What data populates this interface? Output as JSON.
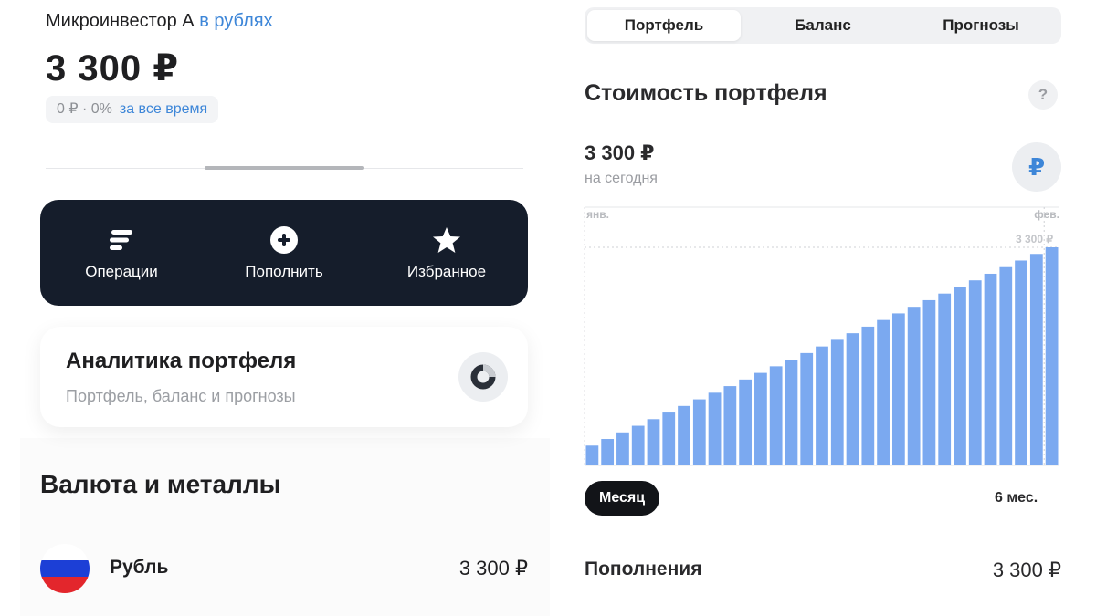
{
  "account": {
    "name": "Микроинвестор А",
    "currency_mode": "в рублях",
    "total": "3 300 ₽",
    "change": "0 ₽ · 0%",
    "change_period": "за все время"
  },
  "actions": [
    {
      "label": "Операции",
      "icon": "operations-icon"
    },
    {
      "label": "Пополнить",
      "icon": "plus-circle-icon"
    },
    {
      "label": "Избранное",
      "icon": "star-icon"
    }
  ],
  "analytics": {
    "title": "Аналитика портфеля",
    "subtitle": "Портфель, баланс и прогнозы",
    "icon": "donut-chart-icon"
  },
  "currencies_section": {
    "title": "Валюта и металлы",
    "items": [
      {
        "name": "Рубль",
        "value": "3 300 ₽",
        "icon": "russia-flag-icon"
      }
    ]
  },
  "tabs": [
    {
      "label": "Портфель",
      "active": true
    },
    {
      "label": "Баланс",
      "active": false
    },
    {
      "label": "Прогнозы",
      "active": false
    }
  ],
  "portfolio": {
    "title": "Стоимость портфеля",
    "help": "?",
    "value": "3 300 ₽",
    "value_caption": "на сегодня",
    "currency_symbol": "₽"
  },
  "chart_data": {
    "type": "bar",
    "x_labels": [
      "янв.",
      "фев."
    ],
    "max_label": "3 300 ₽",
    "values": [
      300,
      400,
      500,
      600,
      700,
      800,
      900,
      1000,
      1100,
      1200,
      1300,
      1400,
      1500,
      1600,
      1700,
      1800,
      1900,
      2000,
      2100,
      2200,
      2300,
      2400,
      2500,
      2600,
      2700,
      2800,
      2900,
      3000,
      3100,
      3200,
      3300
    ],
    "ylim": [
      0,
      3300
    ],
    "bar_color": "#7ba9f0",
    "grid": false
  },
  "periods": {
    "selected": "Месяц",
    "other": "6 мес."
  },
  "deposits": {
    "label": "Пополнения",
    "value": "3 300 ₽"
  },
  "colors": {
    "accent": "#3d86d8",
    "dark_bar": "#151d2b",
    "chart_bar": "#7ba9f0"
  }
}
